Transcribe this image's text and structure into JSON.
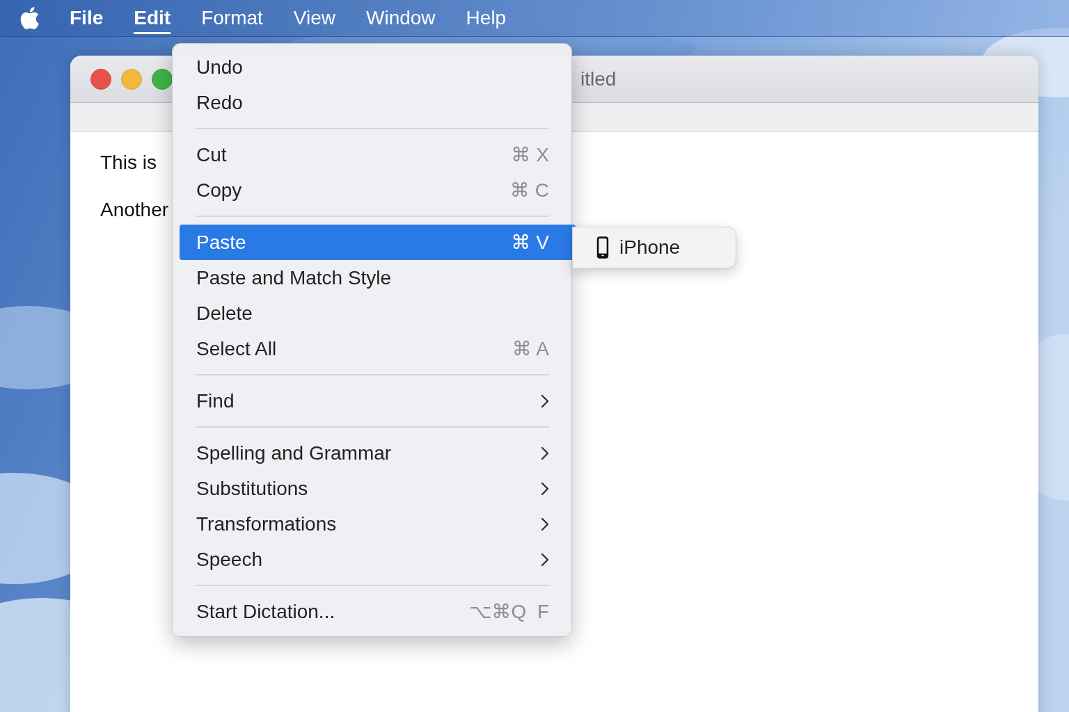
{
  "menu_bar": [
    {
      "label": "File",
      "selected": false
    },
    {
      "label": "Edit",
      "selected": true
    },
    {
      "label": "Format",
      "selected": false
    },
    {
      "label": "View",
      "selected": false
    },
    {
      "label": "Window",
      "selected": false
    },
    {
      "label": "Help",
      "selected": false
    }
  ],
  "window": {
    "title": "itled",
    "lines": [
      "This is",
      "Another"
    ]
  },
  "menu": {
    "groups": [
      [
        {
          "label": "Undo",
          "selected": false
        },
        {
          "label": "Redo",
          "selected": false
        }
      ],
      [
        {
          "label": "Cut",
          "shortcut": "⌘ X",
          "selected": false
        },
        {
          "label": "Copy",
          "shortcut": "⌘ C",
          "selected": false
        }
      ],
      [
        {
          "label": "Paste",
          "shortcut": "⌘ V",
          "selected": true
        },
        {
          "label": "Paste and Match Style",
          "selected": false
        },
        {
          "label": "Delete",
          "selected": false
        },
        {
          "label": "Select All",
          "shortcut": "⌘ A",
          "selected": false
        }
      ],
      [
        {
          "label": "Find",
          "submenu": true,
          "selected": false
        }
      ],
      [
        {
          "label": "Spelling and Grammar",
          "submenu": true,
          "selected": false
        },
        {
          "label": "Substitutions",
          "submenu": true,
          "selected": false
        },
        {
          "label": "Transformations",
          "submenu": true,
          "selected": false
        },
        {
          "label": "Speech",
          "submenu": true,
          "selected": false
        }
      ],
      [
        {
          "label": "Start Dictation...",
          "shortcut": "⌥⌘Q  F",
          "selected": false
        }
      ]
    ]
  },
  "submenu": {
    "items": [
      {
        "label": "iPhone"
      }
    ]
  }
}
